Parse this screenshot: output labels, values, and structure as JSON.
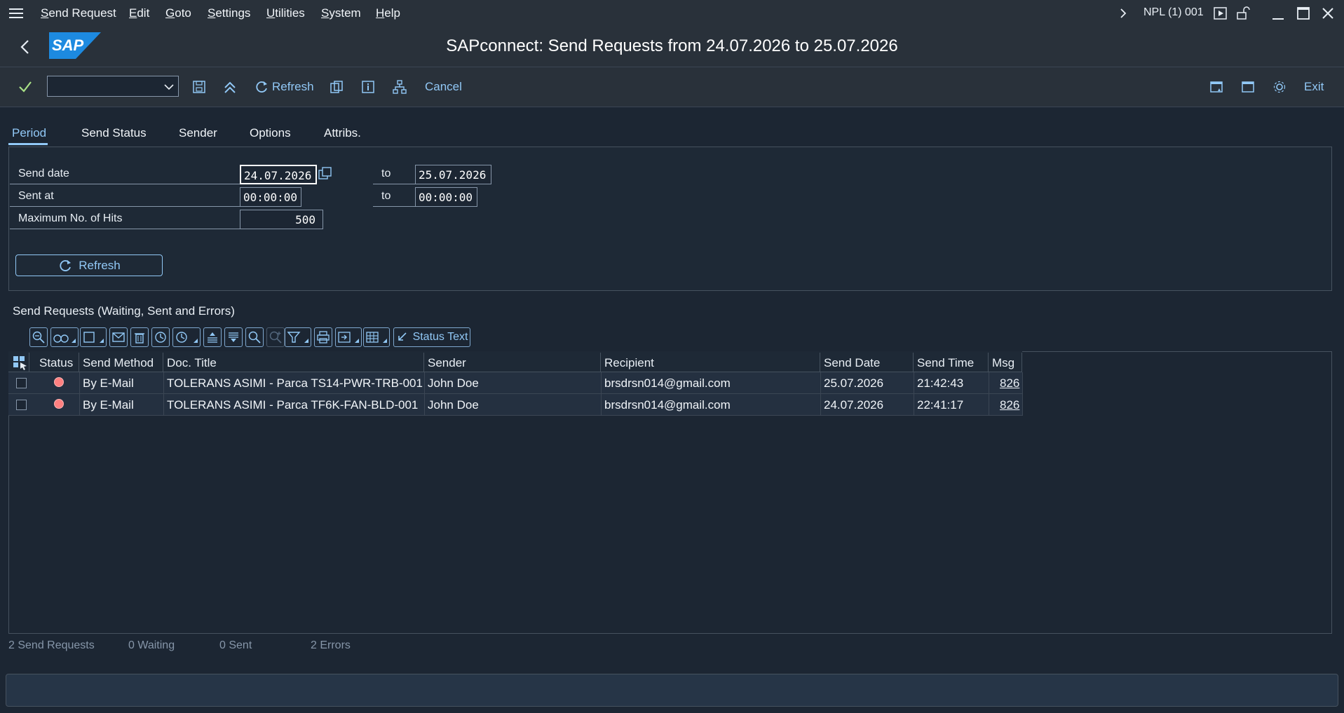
{
  "menu": {
    "items": [
      "Send Request",
      "Edit",
      "Goto",
      "Settings",
      "Utilities",
      "System",
      "Help"
    ],
    "system_info": "NPL (1) 001"
  },
  "titlebar": {
    "title": "SAPconnect: Send Requests from 24.07.2026 to 25.07.2026",
    "logo_text": "SAP"
  },
  "toolbar": {
    "command_field_value": "",
    "refresh_label": "Refresh",
    "cancel_label": "Cancel",
    "exit_label": "Exit"
  },
  "tabs": [
    {
      "label": "Period",
      "active": true
    },
    {
      "label": "Send Status",
      "active": false
    },
    {
      "label": "Sender",
      "active": false
    },
    {
      "label": "Options",
      "active": false
    },
    {
      "label": "Attribs.",
      "active": false
    }
  ],
  "period": {
    "send_date_label": "Send date",
    "send_date_from": "24.07.2026",
    "send_date_to": "25.07.2026",
    "sent_at_label": "Sent at",
    "sent_at_from": "00:00:00",
    "sent_at_to": "00:00:00",
    "max_hits_label": "Maximum No. of Hits",
    "max_hits": "500",
    "to_label": "to",
    "refresh_button": "Refresh"
  },
  "section_title": "Send Requests (Waiting, Sent and Errors)",
  "alv_toolbar": {
    "status_text_button": "Status Text"
  },
  "table": {
    "columns": [
      "Status",
      "Send Method",
      "Doc. Title",
      "Sender",
      "Recipient",
      "Send Date",
      "Send Time",
      "Msg"
    ],
    "rows": [
      {
        "send_method": "By E-Mail",
        "doc_title": "TOLERANS ASIMI - Parca TS14-PWR-TRB-001",
        "sender": "John Doe",
        "recipient": "brsdrsn014@gmail.com",
        "send_date": "25.07.2026",
        "send_time": "21:42:43",
        "msg": "826"
      },
      {
        "send_method": "By E-Mail",
        "doc_title": "TOLERANS ASIMI - Parca TF6K-FAN-BLD-001",
        "sender": "John Doe",
        "recipient": "brsdrsn014@gmail.com",
        "send_date": "24.07.2026",
        "send_time": "22:41:17",
        "msg": "826"
      }
    ]
  },
  "counts": {
    "total": "2 Send Requests",
    "waiting": "0 Waiting",
    "sent": "0 Sent",
    "errors": "2 Errors"
  },
  "colors": {
    "accent": "#91c8f6",
    "error_status": "#ff8080",
    "background": "#1c2633"
  }
}
